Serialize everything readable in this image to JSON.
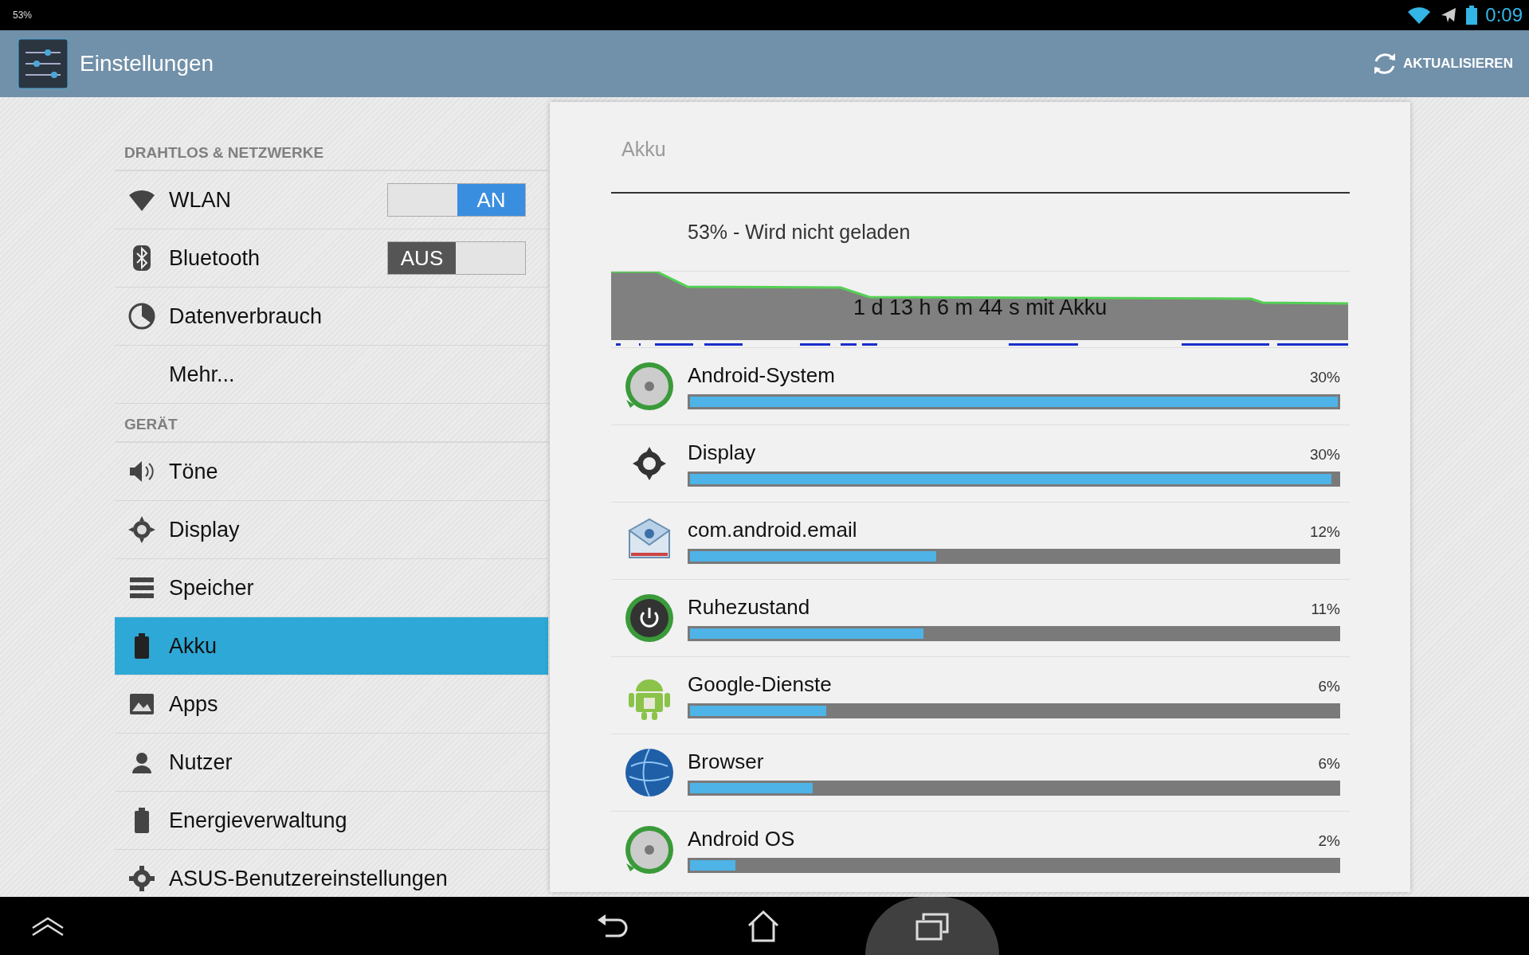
{
  "status_bar": {
    "battery_text": "53%",
    "time": "0:09"
  },
  "action_bar": {
    "title": "Einstellungen",
    "action": "AKTUALISIEREN"
  },
  "sidebar": {
    "sections": [
      {
        "header": "DRAHTLOS & NETZWERKE",
        "items": [
          {
            "label": "WLAN",
            "selected": false,
            "toggle": {
              "on": true,
              "text": "AN"
            }
          },
          {
            "label": "Bluetooth",
            "selected": false,
            "toggle": {
              "on": false,
              "text": "AUS"
            }
          },
          {
            "label": "Datenverbrauch",
            "selected": false
          },
          {
            "label": "Mehr...",
            "selected": false
          }
        ]
      },
      {
        "header": "GERÄT",
        "items": [
          {
            "label": "Töne",
            "selected": false
          },
          {
            "label": "Display",
            "selected": false
          },
          {
            "label": "Speicher",
            "selected": false
          },
          {
            "label": "Akku",
            "selected": true
          },
          {
            "label": "Apps",
            "selected": false
          },
          {
            "label": "Nutzer",
            "selected": false
          },
          {
            "label": "Energieverwaltung",
            "selected": false
          },
          {
            "label": "ASUS-Benutzereinstellungen",
            "selected": false
          }
        ]
      }
    ]
  },
  "panel": {
    "title": "Akku",
    "status": "53% - Wird nicht geladen",
    "graph_caption": "1 d 13 h 6 m 44 s mit Akku",
    "usage": [
      {
        "name": "Android-System",
        "percent": "30%",
        "level": 1.0
      },
      {
        "name": "Display",
        "percent": "30%",
        "level": 0.99
      },
      {
        "name": "com.android.email",
        "percent": "12%",
        "level": 0.38
      },
      {
        "name": "Ruhezustand",
        "percent": "11%",
        "level": 0.36
      },
      {
        "name": "Google-Dienste",
        "percent": "6%",
        "level": 0.21
      },
      {
        "name": "Browser",
        "percent": "6%",
        "level": 0.19
      },
      {
        "name": "Android OS",
        "percent": "2%",
        "level": 0.07
      }
    ]
  }
}
